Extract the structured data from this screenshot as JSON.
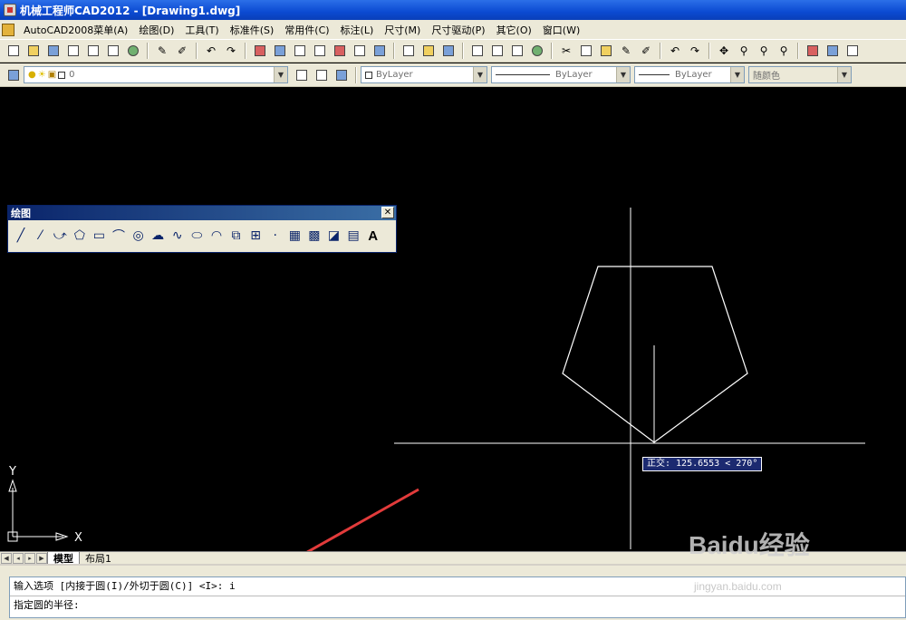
{
  "window": {
    "title": "机械工程师CAD2012 - [Drawing1.dwg]"
  },
  "menu": {
    "items": [
      "AutoCAD2008菜单(A)",
      "绘图(D)",
      "工具(T)",
      "标准件(S)",
      "常用件(C)",
      "标注(L)",
      "尺寸(M)",
      "尺寸驱动(P)",
      "其它(O)",
      "窗口(W)"
    ]
  },
  "layer": {
    "name": "0"
  },
  "properties": {
    "color": "ByLayer",
    "linetype": "ByLayer",
    "lineweight": "ByLayer",
    "plotstyle": "随颜色"
  },
  "draw_toolbar": {
    "title": "绘图",
    "close_glyph": "✕",
    "tools": [
      "line",
      "construction-line",
      "polyline",
      "polygon",
      "rectangle",
      "arc",
      "circle",
      "revcloud",
      "spline",
      "ellipse",
      "ellipse-arc",
      "insert-block",
      "make-block",
      "point",
      "hatch",
      "gradient",
      "region",
      "table",
      "multiline-text"
    ],
    "text_tool_label": "A"
  },
  "tooltip": {
    "text": "正交: 125.6553 < 270°"
  },
  "tabs": {
    "model": "模型",
    "layout1": "布局1"
  },
  "command": {
    "history": "输入选项 [内接于圆(I)/外切于圆(C)] <I>: i",
    "prompt": "指定圆的半径:"
  },
  "ucs": {
    "y_label": "Y",
    "x_label": "X"
  },
  "watermark": {
    "brand": "Baidu经验",
    "url": "jingyan.baidu.com"
  },
  "colors": {
    "canvas": "#000000",
    "entity": "#ffffff",
    "annotation_arrow": "#e23b3b",
    "tooltip_bg": "#1c2a70"
  }
}
